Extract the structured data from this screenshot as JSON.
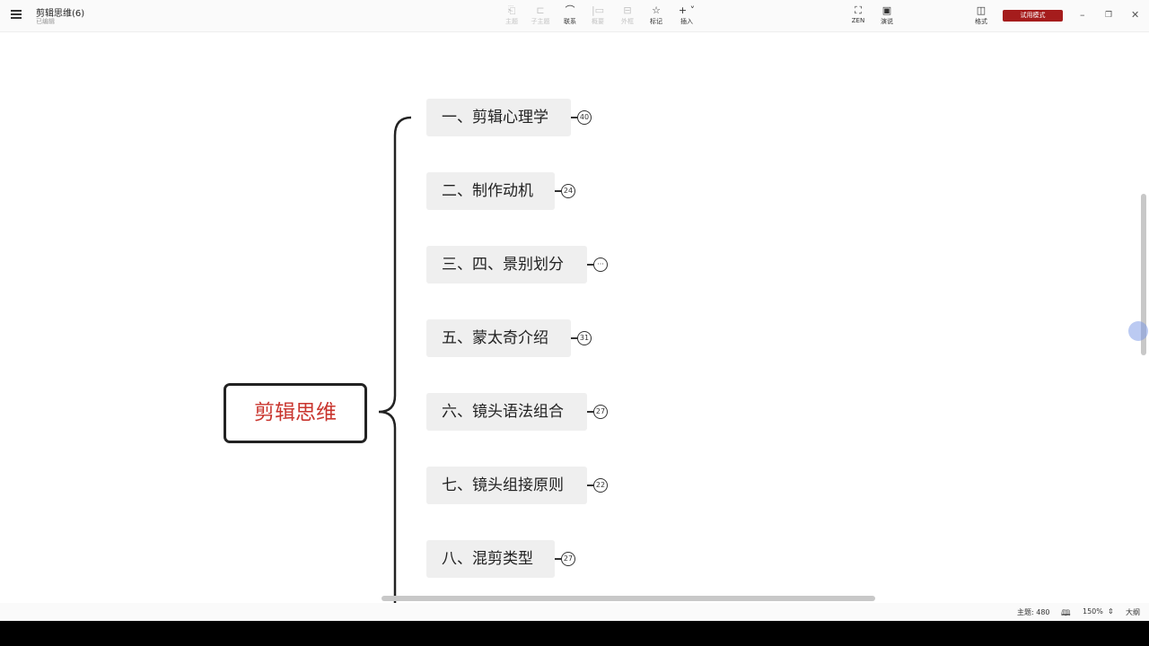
{
  "header": {
    "title": "剪辑思维(6)",
    "subtitle": "已编辑"
  },
  "toolbar": [
    {
      "label": "主题",
      "icon": "topic-icon",
      "enabled": false
    },
    {
      "label": "子主题",
      "icon": "subtopic-icon",
      "enabled": false
    },
    {
      "label": "联系",
      "icon": "relationship-icon",
      "enabled": true
    },
    {
      "label": "概要",
      "icon": "summary-icon",
      "enabled": false
    },
    {
      "label": "外框",
      "icon": "boundary-icon",
      "enabled": false
    },
    {
      "label": "标记",
      "icon": "star-icon",
      "enabled": true
    },
    {
      "label": "插入",
      "icon": "plus-icon",
      "enabled": true
    }
  ],
  "right_toolbar": {
    "zen": "ZEN",
    "present": "演说",
    "format": "格式",
    "trial": "试用模式"
  },
  "root": "剪辑思维",
  "topics": [
    {
      "label": "一、剪辑心理学",
      "count": "40"
    },
    {
      "label": "二、制作动机",
      "count": "24"
    },
    {
      "label": "三、四、景别划分",
      "count": "···"
    },
    {
      "label": "五、蒙太奇介绍",
      "count": "31"
    },
    {
      "label": "六、镜头语法组合",
      "count": "27"
    },
    {
      "label": "七、镜头组接原则",
      "count": "22"
    },
    {
      "label": "八、混剪类型",
      "count": "27"
    }
  ],
  "status": {
    "topics": "主题: 480",
    "zoom": "150%",
    "outline": "大纲"
  },
  "colors": {
    "root_text": "#c9352e",
    "trial": "#a51c1c"
  }
}
